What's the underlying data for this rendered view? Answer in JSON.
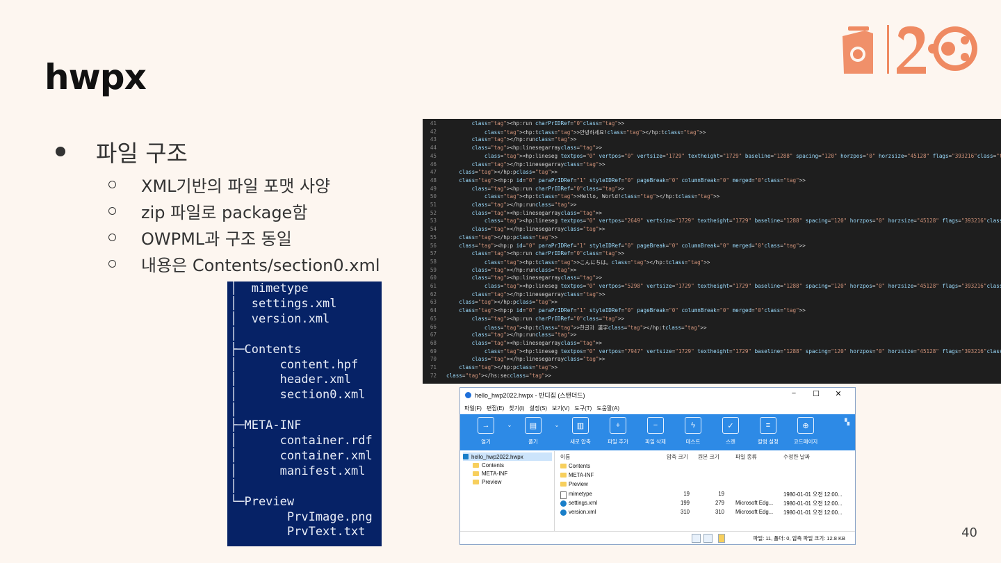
{
  "slide": {
    "title": "hwpx",
    "page_number": "40"
  },
  "bullets": {
    "main": "파일 구조",
    "items": [
      "XML기반의 파일 포맷 사양",
      "zip 파일로 package함",
      "OWPML과 구조 동일",
      "내용은 Contents/section0.xml"
    ]
  },
  "tree": {
    "lines": [
      "│  mimetype",
      "│  settings.xml",
      "│  version.xml",
      "│",
      "├─Contents",
      "│      content.hpf",
      "│      header.xml",
      "│      section0.xml",
      "│",
      "├─META-INF",
      "│      container.rdf",
      "│      container.xml",
      "│      manifest.xml",
      "│",
      "└─Preview",
      "        PrvImage.png",
      "        PrvText.txt"
    ]
  },
  "code": {
    "line_numbers": [
      "41",
      "42",
      "43",
      "44",
      "45",
      "46",
      "47",
      "48",
      "49",
      "50",
      "51",
      "52",
      "53",
      "54",
      "55",
      "56",
      "57",
      "58",
      "59",
      "60",
      "61",
      "62",
      "63",
      "64",
      "65",
      "66",
      "67",
      "68",
      "69",
      "70",
      "71",
      "72"
    ],
    "lines": [
      "        <hp:run charPrIDRef=\"0\">",
      "            <hp:t>안녕하세요!</hp:t>",
      "        </hp:run>",
      "        <hp:linesegarray>",
      "            <hp:lineseg textpos=\"0\" vertpos=\"0\" vertsize=\"1729\" textheight=\"1729\" baseline=\"1288\" spacing=\"120\" horzpos=\"0\" horzsize=\"45128\" flags=\"393216\"/>",
      "        </hp:linesegarray>",
      "    </hp:p>",
      "    <hp:p id=\"0\" paraPrIDRef=\"1\" styleIDRef=\"0\" pageBreak=\"0\" columnBreak=\"0\" merged=\"0\">",
      "        <hp:run charPrIDRef=\"0\">",
      "            <hp:t>Hello, World!</hp:t>",
      "        </hp:run>",
      "        <hp:linesegarray>",
      "            <hp:lineseg textpos=\"0\" vertpos=\"2649\" vertsize=\"1729\" textheight=\"1729\" baseline=\"1288\" spacing=\"120\" horzpos=\"0\" horzsize=\"45128\" flags=\"393216\"/>",
      "        </hp:linesegarray>",
      "    </hp:p>",
      "    <hp:p id=\"0\" paraPrIDRef=\"1\" styleIDRef=\"0\" pageBreak=\"0\" columnBreak=\"0\" merged=\"0\">",
      "        <hp:run charPrIDRef=\"0\">",
      "            <hp:t>こんにちは。</hp:t>",
      "        </hp:run>",
      "        <hp:linesegarray>",
      "            <hp:lineseg textpos=\"0\" vertpos=\"5298\" vertsize=\"1729\" textheight=\"1729\" baseline=\"1288\" spacing=\"120\" horzpos=\"0\" horzsize=\"45128\" flags=\"393216\"/>",
      "        </hp:linesegarray>",
      "    </hp:p>",
      "    <hp:p id=\"0\" paraPrIDRef=\"1\" styleIDRef=\"0\" pageBreak=\"0\" columnBreak=\"0\" merged=\"0\">",
      "        <hp:run charPrIDRef=\"0\">",
      "            <hp:t>한글과 漢字</hp:t>",
      "        </hp:run>",
      "        <hp:linesegarray>",
      "            <hp:lineseg textpos=\"0\" vertpos=\"7947\" vertsize=\"1729\" textheight=\"1729\" baseline=\"1288\" spacing=\"120\" horzpos=\"0\" horzsize=\"45128\" flags=\"393216\"/>",
      "        </hp:linesegarray>",
      "    </hp:p>",
      "</hs:sec>"
    ]
  },
  "bandizip": {
    "title": "hello_hwp2022.hwpx - 반디집 (스탠더드)",
    "menu": [
      "파일(F)",
      "편집(E)",
      "찾기(I)",
      "설정(S)",
      "보기(V)",
      "도구(T)",
      "도움말(A)"
    ],
    "ribbon": [
      {
        "label": "열기",
        "icon": "→"
      },
      {
        "label": "풀기",
        "icon": "▤"
      },
      {
        "label": "새로 압축",
        "icon": "▥"
      },
      {
        "label": "파일 추가",
        "icon": "+"
      },
      {
        "label": "파일 삭제",
        "icon": "−"
      },
      {
        "label": "테스트",
        "icon": "ϟ"
      },
      {
        "label": "스캔",
        "icon": "✓"
      },
      {
        "label": "칼럼 설정",
        "icon": "≡"
      },
      {
        "label": "코드페이지",
        "icon": "⊕"
      }
    ],
    "tree": {
      "root": "hello_hwp2022.hwpx",
      "children": [
        "Contents",
        "META-INF",
        "Preview"
      ]
    },
    "columns": {
      "name": "이름",
      "packed": "압축 크기",
      "size": "원본 크기",
      "type": "파일 종류",
      "date": "수정한 날짜"
    },
    "files": [
      {
        "name": "Contents",
        "packed": "",
        "size": "",
        "type": "",
        "date": "",
        "kind": "folder"
      },
      {
        "name": "META-INF",
        "packed": "",
        "size": "",
        "type": "",
        "date": "",
        "kind": "folder"
      },
      {
        "name": "Preview",
        "packed": "",
        "size": "",
        "type": "",
        "date": "",
        "kind": "folder"
      },
      {
        "name": "mimetype",
        "packed": "19",
        "size": "19",
        "type": "",
        "date": "1980-01-01 오전 12:00...",
        "kind": "file"
      },
      {
        "name": "settings.xml",
        "packed": "199",
        "size": "279",
        "type": "Microsoft Edg...",
        "date": "1980-01-01 오전 12:00...",
        "kind": "edge"
      },
      {
        "name": "version.xml",
        "packed": "310",
        "size": "310",
        "type": "Microsoft Edg...",
        "date": "1980-01-01 오전 12:00...",
        "kind": "edge"
      }
    ],
    "status": "파일: 11, 폴더: 0, 압축 파일 크기: 12.8 KB"
  },
  "colors": {
    "background": "#fdf6f0",
    "logo": "#ef8a62",
    "tree_bg": "#062266",
    "editor_bg": "#1e1e1e",
    "ribbon": "#2d8ae6"
  }
}
